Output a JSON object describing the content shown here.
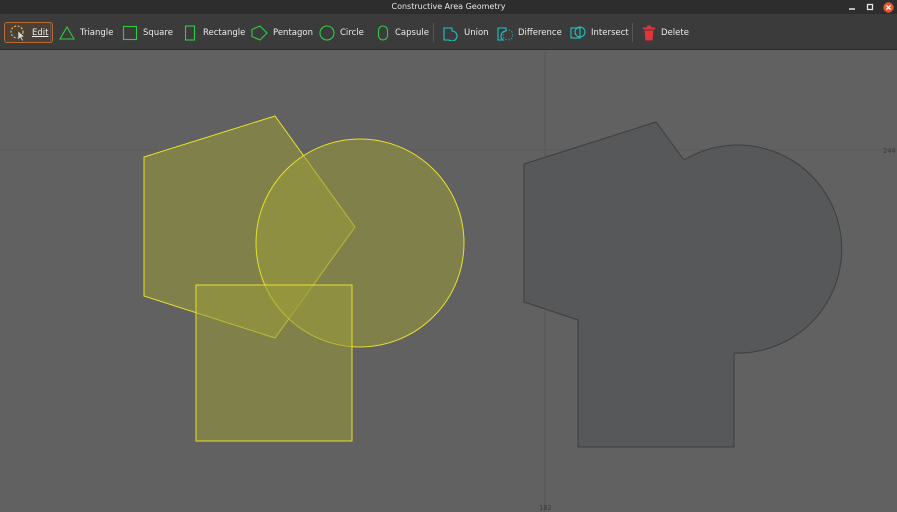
{
  "window": {
    "title": "Constructive Area Geometry",
    "controls": [
      "minimize-icon",
      "maximize-icon",
      "close-icon"
    ]
  },
  "toolbar": {
    "edit": "Edit",
    "triangle": "Triangle",
    "square": "Square",
    "rectangle": "Rectangle",
    "pentagon": "Pentagon",
    "circle": "Circle",
    "capsule": "Capsule",
    "union": "Union",
    "difference": "Difference",
    "intersect": "Intersect",
    "delete": "Delete"
  },
  "canvas": {
    "axis_y_label": "244",
    "axis_x_label": "182"
  },
  "colors": {
    "background": "#616161",
    "toolbar": "#3b3b3b",
    "shape_icon": "#2ecc40",
    "boolean_icon": "#22c4c4",
    "delete_icon": "#e0353a",
    "edit_accent": "#e8b844",
    "selected_stroke": "#e6e02a",
    "selected_fill": "#9a9a3a",
    "result_fill": "#575859",
    "result_stroke": "#3e3e3e"
  }
}
